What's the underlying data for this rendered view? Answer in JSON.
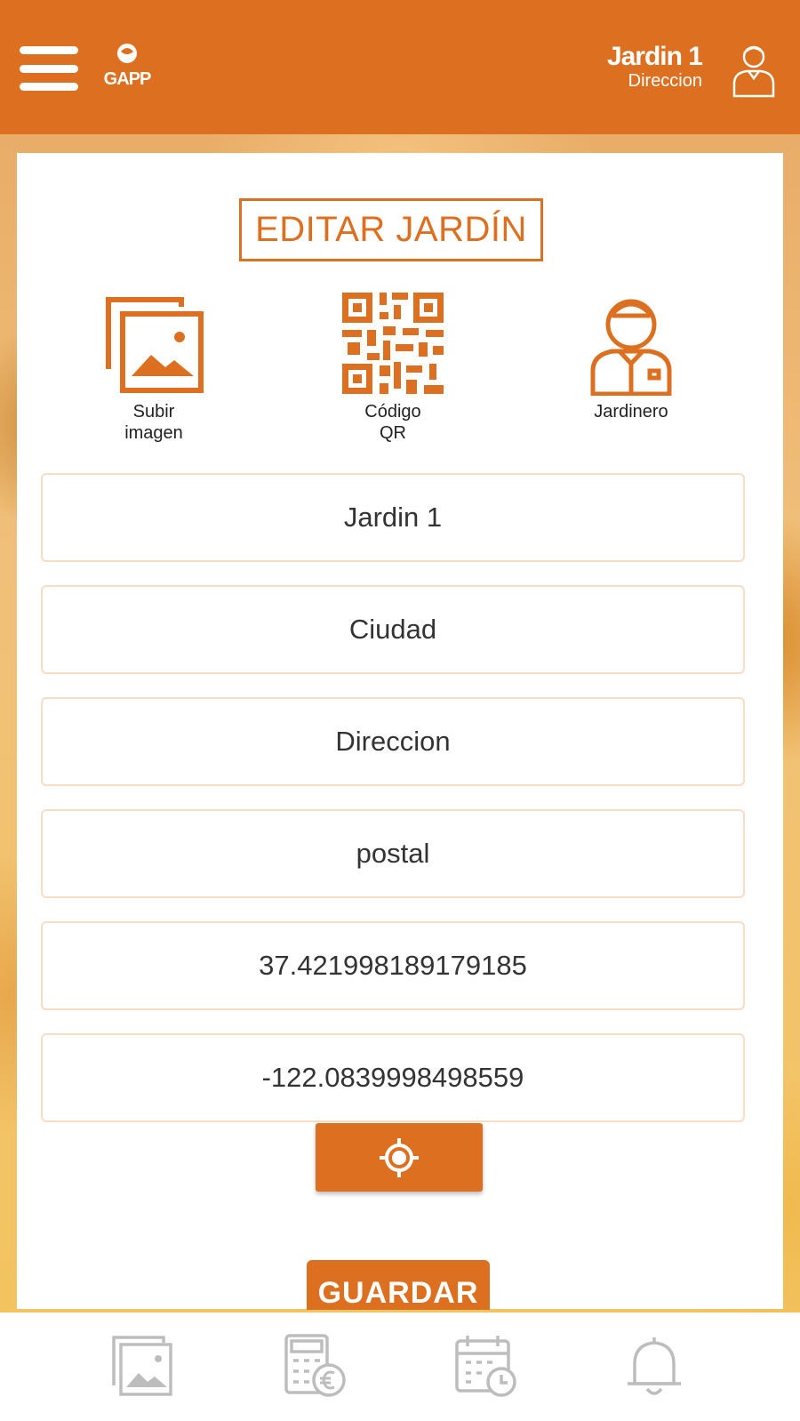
{
  "colors": {
    "accent": "#dc7020",
    "field_border": "#f7dcc6",
    "icon_gray": "#bdbdbd"
  },
  "header": {
    "logo_text": "GAPP",
    "user_name": "Jardin 1",
    "user_subtitle": "Direccion"
  },
  "page": {
    "title": "EDITAR JARDÍN"
  },
  "actions": [
    {
      "label_line1": "Subir",
      "label_line2": "imagen",
      "icon": "image-upload-icon"
    },
    {
      "label_line1": "Código",
      "label_line2": "QR",
      "icon": "qr-code-icon"
    },
    {
      "label_line1": "Jardinero",
      "label_line2": "",
      "icon": "gardener-icon"
    }
  ],
  "fields": {
    "name": "Jardin 1",
    "city": "Ciudad",
    "address": "Direccion",
    "postal": "postal",
    "latitude": "37.421998189179185",
    "longitude": "-122.0839998498559"
  },
  "buttons": {
    "locate_icon": "crosshair-icon",
    "save_label": "GUARDAR"
  },
  "bottom_nav": [
    {
      "icon": "gallery-icon"
    },
    {
      "icon": "calculator-euro-icon"
    },
    {
      "icon": "calendar-clock-icon"
    },
    {
      "icon": "bell-icon"
    }
  ]
}
